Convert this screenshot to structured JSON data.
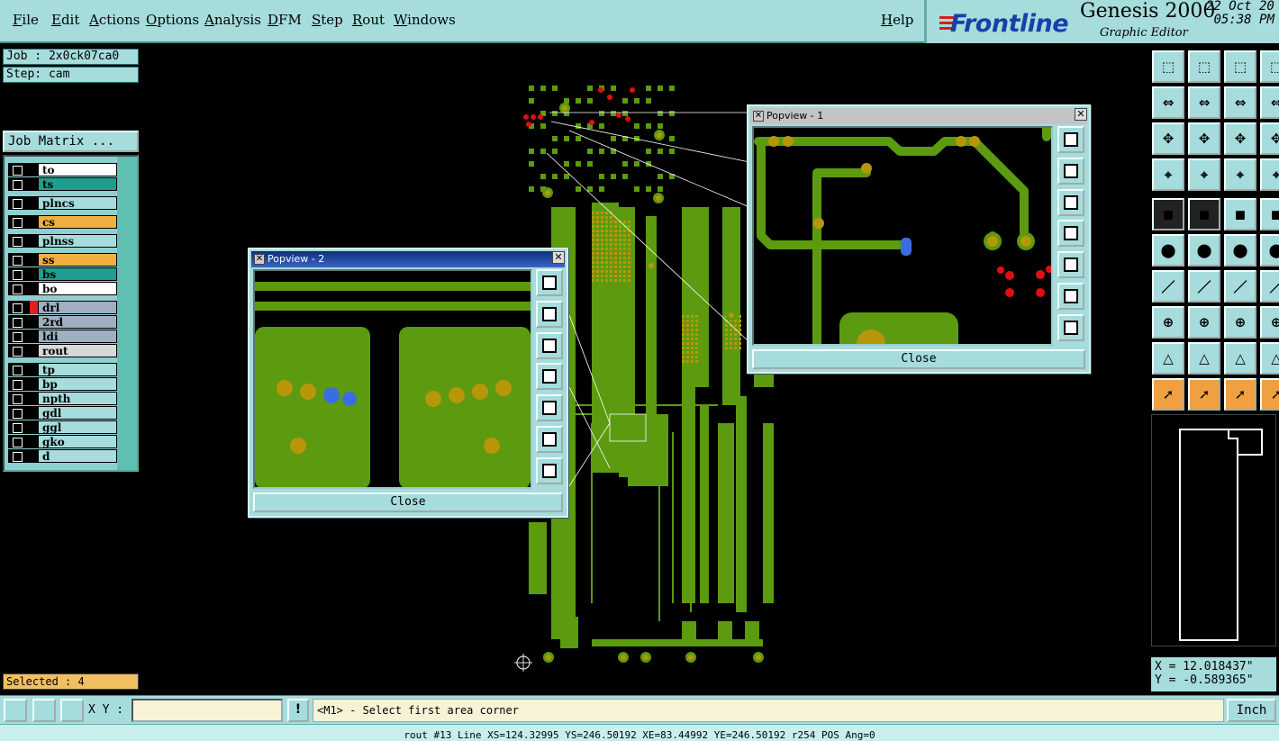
{
  "menu": {
    "file": "File",
    "edit": "Edit",
    "actions": "Actions",
    "options": "Options",
    "analysis": "Analysis",
    "dfm": "DFM",
    "step": "Step",
    "rout": "Rout",
    "windows": "Windows",
    "help": "Help"
  },
  "brand": {
    "logo": "Frontline",
    "product": "Genesis 2000",
    "subtitle": "Graphic Editor",
    "date_line1": "22 Oct 20",
    "date_line2": "05:38 PM"
  },
  "info": {
    "job": "Job : 2x0ck07ca0",
    "step": "Step: cam",
    "job_matrix": "Job Matrix ..."
  },
  "layers": [
    {
      "name": "to",
      "color": "#ffffff"
    },
    {
      "name": "ts",
      "color": "#1f9e8e"
    },
    {
      "name": "plncs",
      "color": "#a6dcdc"
    },
    {
      "name": "cs",
      "color": "#f0b040"
    },
    {
      "name": "plnss",
      "color": "#a6dcdc"
    },
    {
      "name": "ss",
      "color": "#f0b040"
    },
    {
      "name": "bs",
      "color": "#1f9e8e"
    },
    {
      "name": "bo",
      "color": "#ffffff"
    },
    {
      "name": "drl",
      "color": "#a0b0c0"
    },
    {
      "name": "2rd",
      "color": "#a0b0c0"
    },
    {
      "name": "ldi",
      "color": "#a0b0c0"
    },
    {
      "name": "rout",
      "color": "#d8d8d8"
    },
    {
      "name": "tp",
      "color": "#a6dcdc"
    },
    {
      "name": "bp",
      "color": "#a6dcdc"
    },
    {
      "name": "npth",
      "color": "#a6dcdc"
    },
    {
      "name": "gdl",
      "color": "#a6dcdc"
    },
    {
      "name": "ggl",
      "color": "#a6dcdc"
    },
    {
      "name": "gko",
      "color": "#a6dcdc"
    },
    {
      "name": "d",
      "color": "#a6dcdc"
    }
  ],
  "selected": "Selected : 4",
  "popview1": {
    "title": "Popview - 1",
    "close": "Close"
  },
  "popview2": {
    "title": "Popview - 2",
    "close": "Close"
  },
  "coords": {
    "x": "X = 12.018437\"",
    "y": "Y = -0.589365\""
  },
  "cmd": {
    "xy_label": "X Y :",
    "xy_value": "",
    "warn": "!",
    "prompt": "<M1> - Select first area corner",
    "unit": "Inch"
  },
  "status": "rout #13 Line XS=124.32995 YS=246.50192 XE=83.44992 YE=246.50192 r254 POS Ang=0",
  "colors": {
    "copper": "#5c9a10",
    "pad": "#b8960a",
    "drill_red": "#e01010",
    "selected_blue": "#3a6ee0",
    "ui_cyan": "#a6dcdc"
  }
}
